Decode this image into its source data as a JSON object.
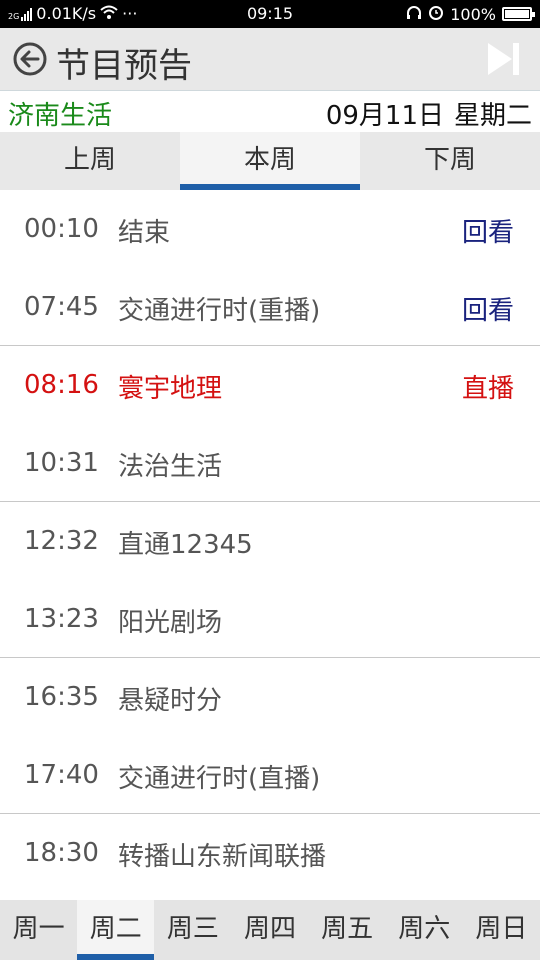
{
  "status_bar": {
    "network_type": "2G",
    "speed": "0.01K/s",
    "more": "···",
    "time": "09:15",
    "battery": "100%",
    "icons": [
      "signal-icon",
      "wifi-icon",
      "headset-icon",
      "alarm-icon",
      "battery-icon"
    ]
  },
  "header": {
    "title": "节目预告",
    "back_icon": "back-circle-icon",
    "skip_icon": "skip-next-icon"
  },
  "channel": {
    "name": "济南生活",
    "date": "09月11日",
    "weekday": "星期二",
    "name_color": "#1a8a1a"
  },
  "week_tabs": [
    {
      "label": "上周",
      "active": false
    },
    {
      "label": "本周",
      "active": true
    },
    {
      "label": "下周",
      "active": false
    }
  ],
  "programs": [
    {
      "time": "00:10",
      "name": "结束",
      "action": "回看",
      "state": "replay"
    },
    {
      "time": "07:45",
      "name": "交通进行时(重播)",
      "action": "回看",
      "state": "replay"
    },
    {
      "time": "08:16",
      "name": "寰宇地理",
      "action": "直播",
      "state": "live"
    },
    {
      "time": "10:31",
      "name": "法治生活",
      "action": "",
      "state": "upcoming"
    },
    {
      "time": "12:32",
      "name": "直通12345",
      "action": "",
      "state": "upcoming"
    },
    {
      "time": "13:23",
      "name": "阳光剧场",
      "action": "",
      "state": "upcoming"
    },
    {
      "time": "16:35",
      "name": "悬疑时分",
      "action": "",
      "state": "upcoming"
    },
    {
      "time": "17:40",
      "name": "交通进行时(直播)",
      "action": "",
      "state": "upcoming"
    },
    {
      "time": "18:30",
      "name": "转播山东新闻联播",
      "action": "",
      "state": "upcoming"
    }
  ],
  "day_tabs": [
    {
      "label": "周一",
      "active": false
    },
    {
      "label": "周二",
      "active": true
    },
    {
      "label": "周三",
      "active": false
    },
    {
      "label": "周四",
      "active": false
    },
    {
      "label": "周五",
      "active": false
    },
    {
      "label": "周六",
      "active": false
    },
    {
      "label": "周日",
      "active": false
    }
  ],
  "colors": {
    "accent": "#1f5fa8",
    "live": "#d41111",
    "replay": "#1a237e"
  }
}
